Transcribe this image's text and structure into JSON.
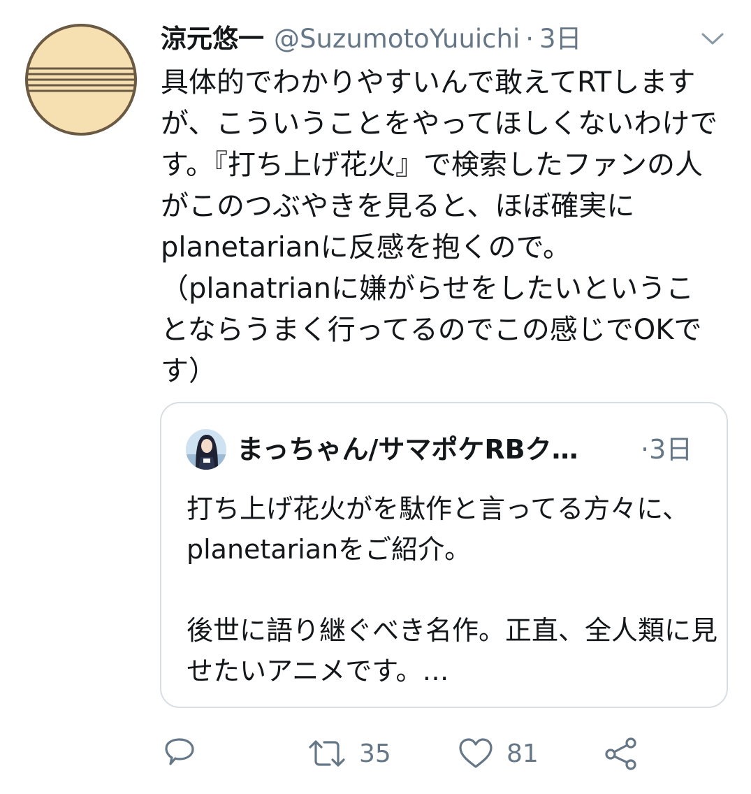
{
  "tweet": {
    "display_name": "涼元悠一",
    "handle": "@SuzumotoYuuichi",
    "separator": "·",
    "time": "3日",
    "avatar_icon": "gold-disc-avatar-icon",
    "more_icon": "chevron-down-icon",
    "text": "具体的でわかりやすいんで敢えてRTしますが、こういうことをやってほしくないわけです。『打ち上げ花火』で検索したファンの人がこのつぶやきを見ると、ほぼ確実にplanetarianに反感を抱くので。\n（planatrianに嫌がらせをしたいということならうまく行ってるのでこの感じでOKです）"
  },
  "quoted_tweet": {
    "display_name": "まっちゃん/サマポケRBク…",
    "separator": "·",
    "time": "3日",
    "avatar_icon": "anime-character-avatar-icon",
    "text": "打ち上げ花火がを駄作と言ってる方々に、planetarianをご紹介。\n\n後世に語り継ぐべき名作。正直、全人類に見せたいアニメです。…"
  },
  "actions": {
    "reply_icon": "reply-icon",
    "retweet_icon": "retweet-icon",
    "retweet_count": "35",
    "like_icon": "heart-icon",
    "like_count": "81",
    "share_icon": "share-icon"
  },
  "colors": {
    "text": "#14171a",
    "secondary": "#657786",
    "border": "#d9dee2"
  }
}
